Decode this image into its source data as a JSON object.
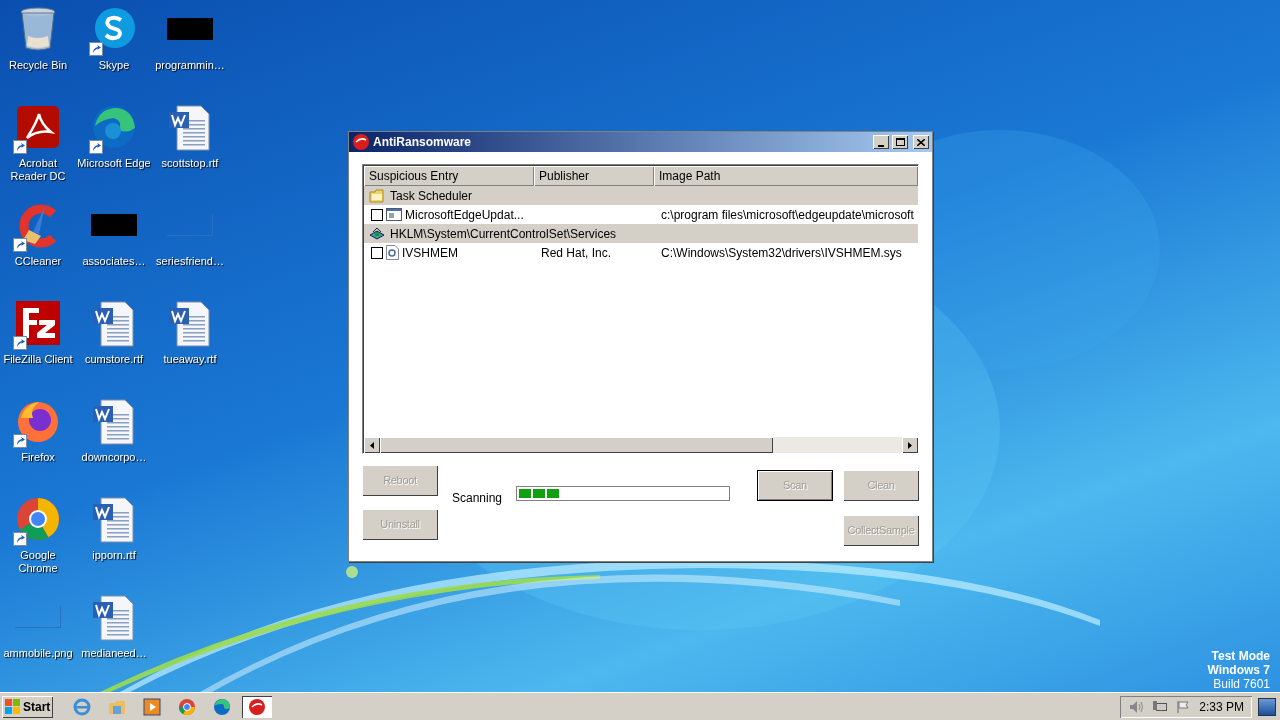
{
  "desktop_icons": [
    [
      {
        "label": "Recycle Bin",
        "kind": "recycle",
        "shortcut": false
      },
      {
        "label": "Acrobat Reader DC",
        "kind": "acrobat",
        "shortcut": true
      },
      {
        "label": "CCleaner",
        "kind": "ccleaner",
        "shortcut": true
      },
      {
        "label": "FileZilla Client",
        "kind": "filezilla",
        "shortcut": true
      },
      {
        "label": "Firefox",
        "kind": "firefox",
        "shortcut": true
      },
      {
        "label": "Google Chrome",
        "kind": "chrome",
        "shortcut": true
      },
      {
        "label": "ammobile.png",
        "kind": "blank",
        "shortcut": false
      }
    ],
    [
      {
        "label": "Skype",
        "kind": "skype",
        "shortcut": true
      },
      {
        "label": "Microsoft Edge",
        "kind": "edge",
        "shortcut": true
      },
      {
        "label": "associates…",
        "kind": "dark",
        "shortcut": false
      },
      {
        "label": "cumstore.rtf",
        "kind": "word",
        "shortcut": false
      },
      {
        "label": "downcorpo…",
        "kind": "word",
        "shortcut": false
      },
      {
        "label": "ipporn.rtf",
        "kind": "word",
        "shortcut": false
      },
      {
        "label": "medianeed…",
        "kind": "word",
        "shortcut": false
      }
    ],
    [
      {
        "label": "programmin…",
        "kind": "dark",
        "shortcut": false
      },
      {
        "label": "scottstop.rtf",
        "kind": "word",
        "shortcut": false
      },
      {
        "label": "seriesfriend…",
        "kind": "blank",
        "shortcut": false
      },
      {
        "label": "tueaway.rtf",
        "kind": "word",
        "shortcut": false
      }
    ]
  ],
  "window": {
    "title": "AntiRansomware",
    "table": {
      "columns": [
        "Suspicious Entry",
        "Publisher",
        "Image Path"
      ],
      "rows": [
        {
          "kind": "group",
          "label": "Task Scheduler"
        },
        {
          "kind": "entry",
          "checked": false,
          "entry": "MicrosoftEdgeUpdat...",
          "publisher": "",
          "path": "c:\\program files\\microsoft\\edgeupdate\\microsoft"
        },
        {
          "kind": "group",
          "label": "HKLM\\System\\CurrentControlSet\\Services"
        },
        {
          "kind": "entry",
          "checked": false,
          "entry": "IVSHMEM",
          "publisher": "Red Hat, Inc.",
          "path": "C:\\Windows\\System32\\drivers\\IVSHMEM.sys"
        }
      ]
    },
    "buttons_left": [
      {
        "label": "Reboot",
        "disabled": true
      },
      {
        "label": "Uninstall",
        "disabled": true
      }
    ],
    "status": {
      "label": "Scanning",
      "level": 0.2
    },
    "buttons_right": [
      {
        "label": "Scan",
        "disabled": true,
        "default": true
      },
      {
        "label": "Clean",
        "disabled": true,
        "default": false
      },
      {
        "label": "CollectSample",
        "disabled": true,
        "default": false
      }
    ]
  },
  "os_info": [
    "Test Mode",
    "Windows 7",
    "Build 7601"
  ],
  "taskbar": {
    "start": "Start",
    "apps": [
      {
        "kind": "ie",
        "selected": false
      },
      {
        "kind": "explorer",
        "selected": false
      },
      {
        "kind": "media",
        "selected": false
      },
      {
        "kind": "chrome",
        "selected": false
      },
      {
        "kind": "edge",
        "selected": false
      },
      {
        "kind": "antiransom",
        "selected": true
      }
    ],
    "clock": "2:33 PM"
  }
}
